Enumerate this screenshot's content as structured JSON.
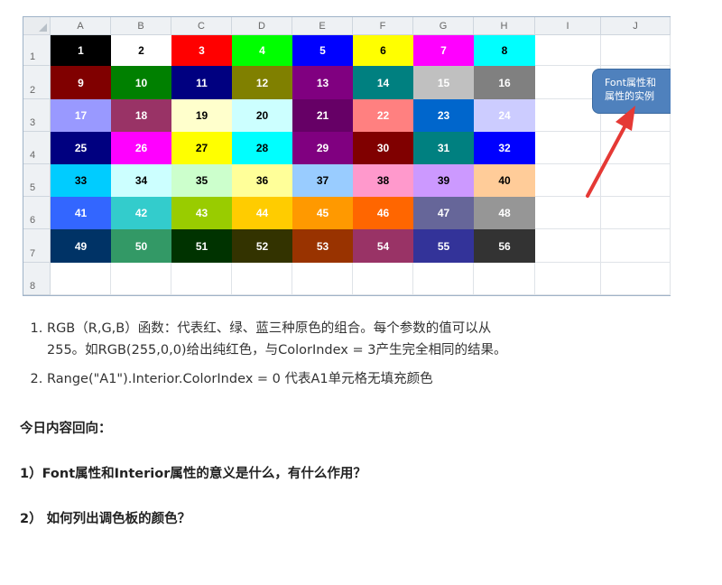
{
  "spreadsheet": {
    "column_headers": [
      "A",
      "B",
      "C",
      "D",
      "E",
      "F",
      "G",
      "H",
      "I",
      "J"
    ],
    "row_headers": [
      "1",
      "2",
      "3",
      "4",
      "5",
      "6",
      "7",
      "8"
    ],
    "color_cells": [
      {
        "v": "1",
        "bg": "#000000",
        "fg": "#ffffff"
      },
      {
        "v": "2",
        "bg": "#ffffff",
        "fg": "#000000"
      },
      {
        "v": "3",
        "bg": "#ff0000",
        "fg": "#ffffff"
      },
      {
        "v": "4",
        "bg": "#00ff00",
        "fg": "#ffffff"
      },
      {
        "v": "5",
        "bg": "#0000ff",
        "fg": "#ffffff"
      },
      {
        "v": "6",
        "bg": "#ffff00",
        "fg": "#000000"
      },
      {
        "v": "7",
        "bg": "#ff00ff",
        "fg": "#ffffff"
      },
      {
        "v": "8",
        "bg": "#00ffff",
        "fg": "#000000"
      },
      {
        "v": "9",
        "bg": "#800000",
        "fg": "#ffffff"
      },
      {
        "v": "10",
        "bg": "#008000",
        "fg": "#ffffff"
      },
      {
        "v": "11",
        "bg": "#000080",
        "fg": "#ffffff"
      },
      {
        "v": "12",
        "bg": "#808000",
        "fg": "#ffffff"
      },
      {
        "v": "13",
        "bg": "#800080",
        "fg": "#ffffff"
      },
      {
        "v": "14",
        "bg": "#008080",
        "fg": "#ffffff"
      },
      {
        "v": "15",
        "bg": "#c0c0c0",
        "fg": "#ffffff"
      },
      {
        "v": "16",
        "bg": "#808080",
        "fg": "#ffffff"
      },
      {
        "v": "17",
        "bg": "#9999ff",
        "fg": "#ffffff"
      },
      {
        "v": "18",
        "bg": "#993366",
        "fg": "#ffffff"
      },
      {
        "v": "19",
        "bg": "#ffffcc",
        "fg": "#000000"
      },
      {
        "v": "20",
        "bg": "#ccffff",
        "fg": "#000000"
      },
      {
        "v": "21",
        "bg": "#660066",
        "fg": "#ffffff"
      },
      {
        "v": "22",
        "bg": "#ff8080",
        "fg": "#ffffff"
      },
      {
        "v": "23",
        "bg": "#0066cc",
        "fg": "#ffffff"
      },
      {
        "v": "24",
        "bg": "#ccccff",
        "fg": "#ffffff"
      },
      {
        "v": "25",
        "bg": "#000080",
        "fg": "#ffffff"
      },
      {
        "v": "26",
        "bg": "#ff00ff",
        "fg": "#ffffff"
      },
      {
        "v": "27",
        "bg": "#ffff00",
        "fg": "#000000"
      },
      {
        "v": "28",
        "bg": "#00ffff",
        "fg": "#000000"
      },
      {
        "v": "29",
        "bg": "#800080",
        "fg": "#ffffff"
      },
      {
        "v": "30",
        "bg": "#800000",
        "fg": "#ffffff"
      },
      {
        "v": "31",
        "bg": "#008080",
        "fg": "#ffffff"
      },
      {
        "v": "32",
        "bg": "#0000ff",
        "fg": "#ffffff"
      },
      {
        "v": "33",
        "bg": "#00ccff",
        "fg": "#000000"
      },
      {
        "v": "34",
        "bg": "#ccffff",
        "fg": "#000000"
      },
      {
        "v": "35",
        "bg": "#ccffcc",
        "fg": "#000000"
      },
      {
        "v": "36",
        "bg": "#ffff99",
        "fg": "#000000"
      },
      {
        "v": "37",
        "bg": "#99ccff",
        "fg": "#000000"
      },
      {
        "v": "38",
        "bg": "#ff99cc",
        "fg": "#000000"
      },
      {
        "v": "39",
        "bg": "#cc99ff",
        "fg": "#000000"
      },
      {
        "v": "40",
        "bg": "#ffcc99",
        "fg": "#000000"
      },
      {
        "v": "41",
        "bg": "#3366ff",
        "fg": "#ffffff"
      },
      {
        "v": "42",
        "bg": "#33cccc",
        "fg": "#ffffff"
      },
      {
        "v": "43",
        "bg": "#99cc00",
        "fg": "#ffffff"
      },
      {
        "v": "44",
        "bg": "#ffcc00",
        "fg": "#ffffff"
      },
      {
        "v": "45",
        "bg": "#ff9900",
        "fg": "#ffffff"
      },
      {
        "v": "46",
        "bg": "#ff6600",
        "fg": "#ffffff"
      },
      {
        "v": "47",
        "bg": "#666699",
        "fg": "#ffffff"
      },
      {
        "v": "48",
        "bg": "#969696",
        "fg": "#ffffff"
      },
      {
        "v": "49",
        "bg": "#003366",
        "fg": "#ffffff"
      },
      {
        "v": "50",
        "bg": "#339966",
        "fg": "#ffffff"
      },
      {
        "v": "51",
        "bg": "#003300",
        "fg": "#ffffff"
      },
      {
        "v": "52",
        "bg": "#333300",
        "fg": "#ffffff"
      },
      {
        "v": "53",
        "bg": "#993300",
        "fg": "#ffffff"
      },
      {
        "v": "54",
        "bg": "#993366",
        "fg": "#ffffff"
      },
      {
        "v": "55",
        "bg": "#333399",
        "fg": "#ffffff"
      },
      {
        "v": "56",
        "bg": "#333333",
        "fg": "#ffffff"
      }
    ],
    "callout_lines": [
      "Font属性和",
      "属性的实例"
    ],
    "arrow_color": "#e53935"
  },
  "notes": [
    "RGB（R,G,B）函数：代表红、绿、蓝三种原色的组合。每个参数的值可以从\n255。如RGB(255,0,0)给出纯红色，与ColorIndex = 3产生完全相同的结果。",
    "Range(\"A1\").Interior.ColorIndex = 0 代表A1单元格无填充颜色"
  ],
  "review": {
    "title": "今日内容回向：",
    "q1": "1）Font属性和Interior属性的意义是什么，有什么作用？",
    "q2": "2） 如何列出调色板的颜色？"
  }
}
